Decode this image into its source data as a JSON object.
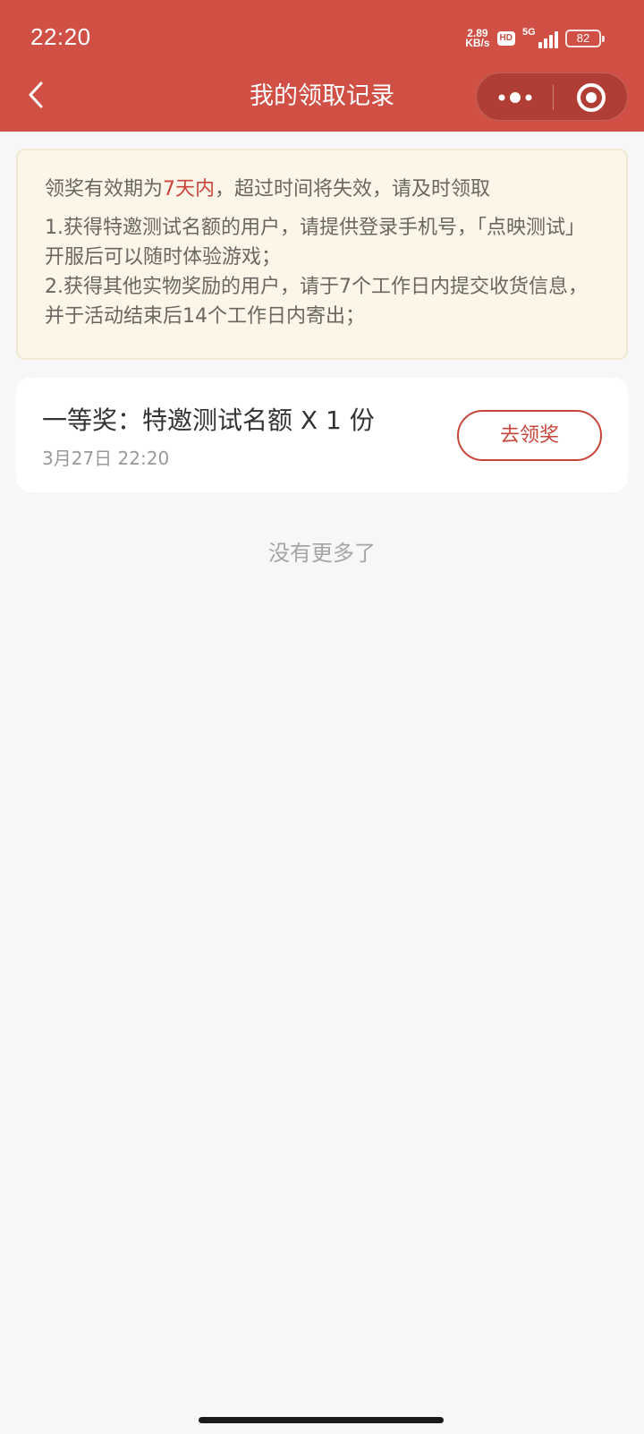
{
  "status_bar": {
    "time": "22:20",
    "net_speed_value": "2.89",
    "net_speed_unit": "KB/s",
    "hd_badge": "HD",
    "network_type": "5G",
    "battery_level": "82"
  },
  "nav": {
    "title": "我的领取记录",
    "back_icon": "chevron-left-icon",
    "more_icon": "more-dots-icon",
    "close_icon": "target-circle-icon",
    "bar_color": "#d05046"
  },
  "notice": {
    "head_prefix": "领奖有效期为",
    "head_highlight": "7天内",
    "head_suffix": "，超过时间将失效，请及时领取",
    "items": [
      "1.获得特邀测试名额的用户，请提供登录手机号，「点映测试」开服后可以随时体验游戏；",
      "2.获得其他实物奖励的用户，请于7个工作日内提交收货信息，并于活动结束后14个工作日内寄出；"
    ]
  },
  "prizes": [
    {
      "name": "一等奖：特邀测试名额 X 1 份",
      "time": "3月27日 22:20",
      "action_label": "去领奖"
    }
  ],
  "footer": {
    "no_more_text": "没有更多了"
  },
  "colors": {
    "accent": "#c9453c",
    "notice_bg": "#fcf6e9",
    "page_bg": "#f7f7f7"
  }
}
